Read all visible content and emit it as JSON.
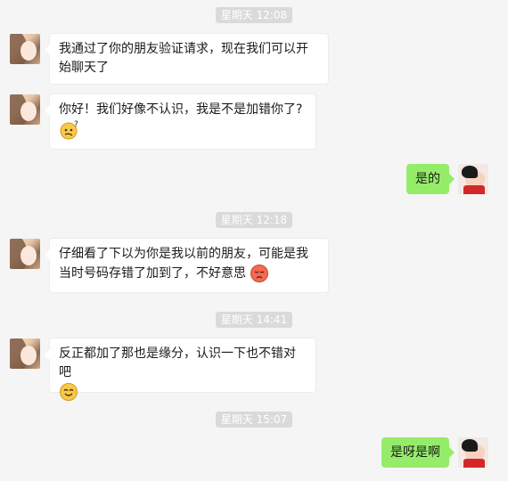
{
  "colors": {
    "background": "#f5f5f5",
    "incoming_bubble": "#ffffff",
    "outgoing_bubble": "#95ec69",
    "timestamp_bg": "#dadada"
  },
  "timestamps": [
    "星期天 12:08",
    "星期天 12:18",
    "星期天 14:41",
    "星期天 15:07"
  ],
  "messages": [
    {
      "from": "contact",
      "text": "我通过了你的朋友验证请求，现在我们可以开始聊天了"
    },
    {
      "from": "contact",
      "text": "你好！我们好像不认识，我是不是加错你了?",
      "emoji": "confused-face-emoji"
    },
    {
      "from": "me",
      "text": "是的"
    },
    {
      "from": "contact",
      "text": "仔细看了下以为你是我以前的朋友，可能是我当时号码存错了加到了，不好意思",
      "emoji": "sad-face-emoji"
    },
    {
      "from": "contact",
      "text": "反正都加了那也是缘分，认识一下也不错对吧",
      "emoji": "smile-face-emoji"
    },
    {
      "from": "me",
      "text": "是呀是啊"
    }
  ]
}
